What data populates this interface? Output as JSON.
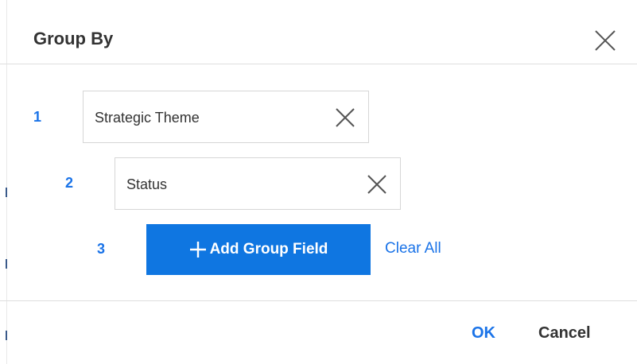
{
  "dialog": {
    "title": "Group By",
    "close_icon": "close-icon"
  },
  "groups": [
    {
      "number": "1",
      "field": "Strategic Theme",
      "remove_icon": "close-icon"
    },
    {
      "number": "2",
      "field": "Status",
      "remove_icon": "close-icon"
    }
  ],
  "add_row": {
    "number": "3",
    "add_label": "Add Group Field",
    "add_icon": "plus-icon",
    "clear_label": "Clear All"
  },
  "footer": {
    "ok_label": "OK",
    "cancel_label": "Cancel"
  },
  "colors": {
    "accent": "#1a73e8",
    "button_bg": "#0f76e1",
    "text": "#333333",
    "border": "#d6d6d6"
  }
}
